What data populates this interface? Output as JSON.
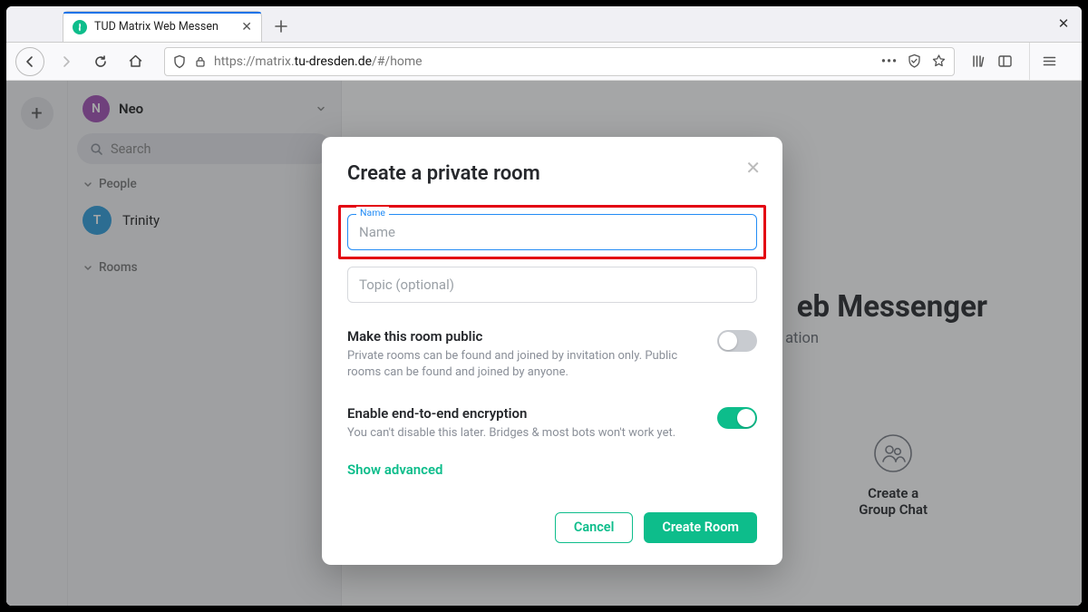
{
  "browser": {
    "tab_title": "TUD Matrix Web Messen",
    "url_proto": "https://",
    "url_prehost": "matrix.",
    "url_host": "tu-dresden.de",
    "url_path": "/#/home"
  },
  "sidebar": {
    "user_initial": "N",
    "user_name": "Neo",
    "search_placeholder": "Search",
    "section_people": "People",
    "dm0_initial": "T",
    "dm0_name": "Trinity",
    "section_rooms": "Rooms"
  },
  "main": {
    "hero_title_tail": "eb Messenger",
    "hero_sub_tail": "ation",
    "card_line1": "Create a",
    "card_line2": "Group Chat"
  },
  "modal": {
    "title": "Create a private room",
    "name_label": "Name",
    "name_placeholder": "Name",
    "topic_placeholder": "Topic (optional)",
    "opt_public_title": "Make this room public",
    "opt_public_desc": "Private rooms can be found and joined by invitation only. Public rooms can be found and joined by anyone.",
    "opt_e2e_title": "Enable end-to-end encryption",
    "opt_e2e_desc": "You can't disable this later. Bridges & most bots won't work yet.",
    "show_advanced": "Show advanced",
    "cancel": "Cancel",
    "create": "Create Room"
  }
}
